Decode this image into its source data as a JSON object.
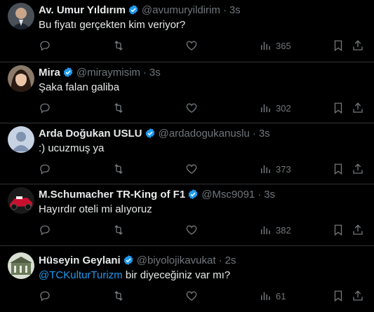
{
  "tweets": [
    {
      "name": "Av. Umur Yıldırım",
      "handle": "@avumuryildirim",
      "time": "3s",
      "text": "Bu fiyatı gerçekten kim veriyor?",
      "views": "365",
      "avatar": "avatar-man-suit"
    },
    {
      "name": "Mira",
      "handle": "@miraymisim",
      "time": "3s",
      "text": "Şaka falan galiba",
      "views": "302",
      "avatar": "avatar-woman"
    },
    {
      "name": "Arda Doğukan USLU",
      "handle": "@ardadogukanuslu",
      "time": "3s",
      "text": ":) ucuzmuş ya",
      "views": "373",
      "avatar": "avatar-default"
    },
    {
      "name": "M.Schumacher TR-King of F1",
      "handle": "@Msc9091",
      "time": "3s",
      "text": "Hayırdır oteli mi alıyoruz",
      "views": "382",
      "avatar": "avatar-f1-car"
    },
    {
      "name": "Hüseyin Geylani",
      "handle": "@biyolojikavukat",
      "time": "2s",
      "mention": "@TCKulturTurizm",
      "text": " bir diyeceğiniz var mı?",
      "views": "61",
      "avatar": "avatar-building"
    }
  ],
  "colors": {
    "background": "#000000",
    "text": "#e7e9ea",
    "muted": "#71767b",
    "accent": "#1d9bf0",
    "divider": "#2f3336"
  }
}
